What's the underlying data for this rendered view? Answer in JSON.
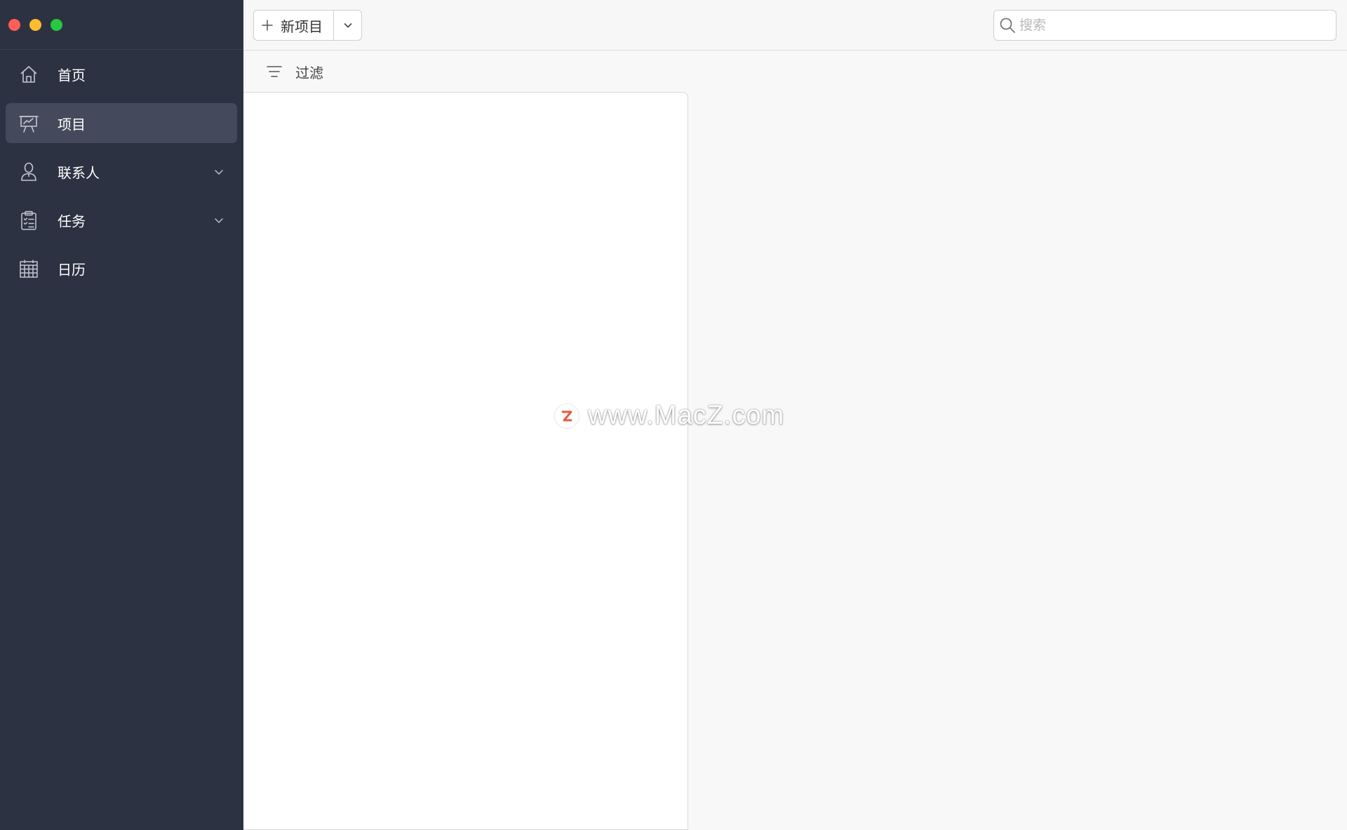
{
  "window": {
    "traffic_lights": [
      "close",
      "minimize",
      "zoom"
    ],
    "traffic_colors": {
      "close": "#ff5f57",
      "minimize": "#febc2e",
      "zoom": "#28c840"
    }
  },
  "sidebar": {
    "background": "#2d3242",
    "active_background": "#444a5b",
    "items": [
      {
        "label": "首页",
        "icon": "home-icon",
        "active": false,
        "expandable": false
      },
      {
        "label": "项目",
        "icon": "presentation-board-icon",
        "active": true,
        "expandable": false
      },
      {
        "label": "联系人",
        "icon": "person-icon",
        "active": false,
        "expandable": true
      },
      {
        "label": "任务",
        "icon": "clipboard-checklist-icon",
        "active": false,
        "expandable": true
      },
      {
        "label": "日历",
        "icon": "calendar-grid-icon",
        "active": false,
        "expandable": false
      }
    ]
  },
  "toolbar": {
    "new_project_label": "新项目",
    "new_project_icon": "plus-icon",
    "dropdown_icon": "chevron-down-icon",
    "search": {
      "placeholder": "搜索",
      "value": "",
      "icon": "search-icon"
    }
  },
  "filter": {
    "label": "过滤",
    "icon": "filter-lines-icon"
  },
  "watermark": {
    "text": "www.MacZ.com",
    "logo_letter": "Z",
    "logo_color": "#e8472b"
  }
}
